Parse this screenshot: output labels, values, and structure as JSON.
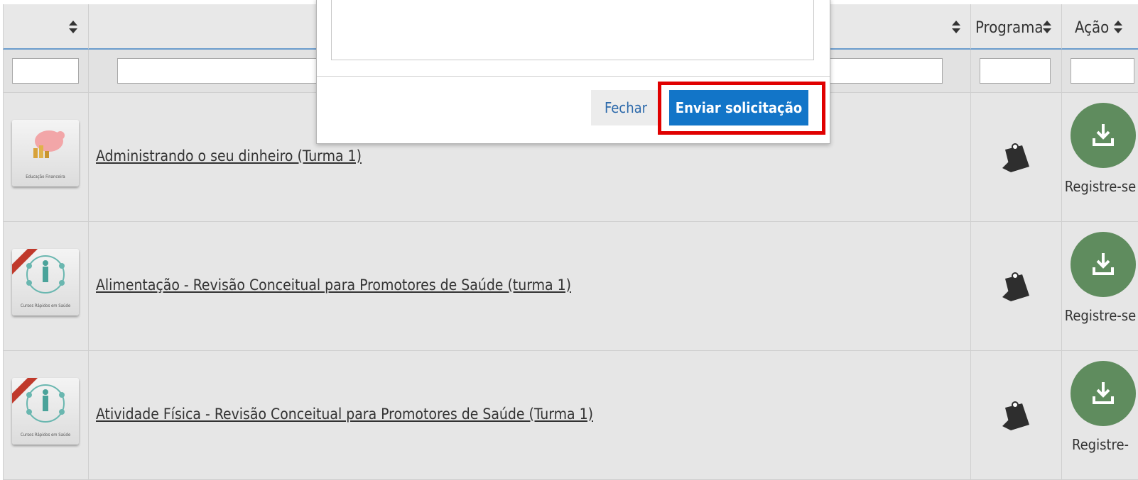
{
  "table": {
    "headers": {
      "col1": "",
      "col2": "",
      "program": "Programa",
      "action": "Ação"
    },
    "rows": [
      {
        "thumb_caption": "Educação Financeira",
        "title": "Administrando o seu dinheiro (Turma 1)",
        "action_label": "Registre-se"
      },
      {
        "thumb_caption": "Cursos Rápidos em Saúde",
        "title": "Alimentação - Revisão Conceitual para Promotores de Saúde (turma 1)",
        "action_label": "Registre-se"
      },
      {
        "thumb_caption": "Cursos Rápidos em Saúde",
        "title": "Atividade Física - Revisão Conceitual para Promotores de Saúde (Turma 1)",
        "action_label": "Registre-"
      }
    ]
  },
  "modal": {
    "close_label": "Fechar",
    "send_label": "Enviar solicitação"
  },
  "colors": {
    "action_green": "#5f8c5e",
    "primary_blue": "#1275c8",
    "highlight_red": "#e00000"
  }
}
